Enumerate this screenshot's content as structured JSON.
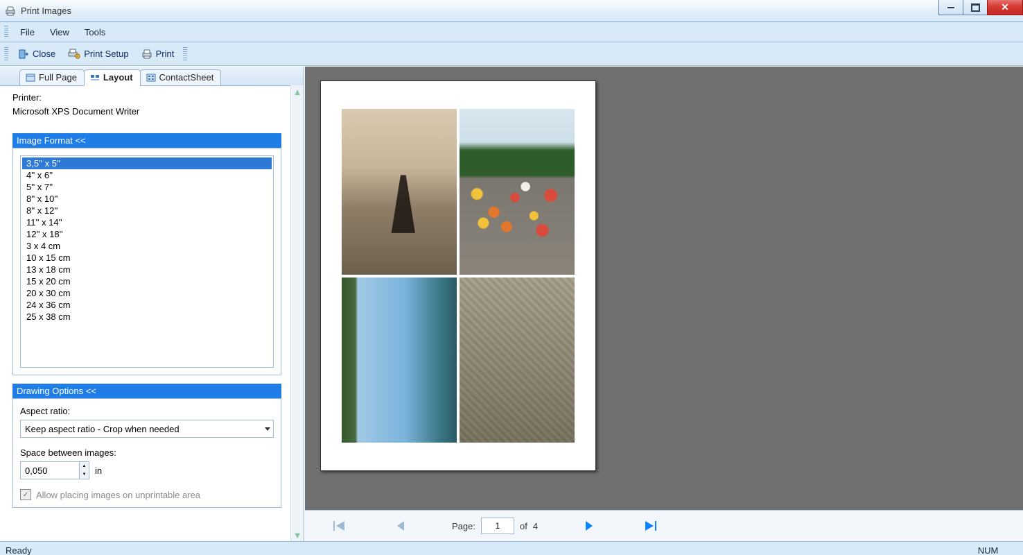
{
  "window": {
    "title": "Print Images"
  },
  "menu": {
    "items": [
      "File",
      "View",
      "Tools"
    ]
  },
  "toolbar": {
    "close": "Close",
    "printSetup": "Print Setup",
    "print": "Print"
  },
  "tabs": {
    "fullPage": "Full Page",
    "layout": "Layout",
    "contactSheet": "ContactSheet"
  },
  "printer": {
    "label": "Printer:",
    "name": "Microsoft XPS Document Writer"
  },
  "imageFormat": {
    "header": "Image Format  <<",
    "options": [
      "3,5'' x 5''",
      "4'' x 6''",
      "5'' x 7''",
      "8'' x 10''",
      "8'' x 12''",
      "11'' x 14''",
      "12'' x 18''",
      "3 x 4 cm",
      "10 x 15 cm",
      "13 x 18 cm",
      "15 x 20 cm",
      "20 x 30 cm",
      "24 x 36 cm",
      "25 x 38 cm"
    ],
    "selectedIndex": 0
  },
  "drawingOptions": {
    "header": "Drawing Options  <<",
    "aspectLabel": "Aspect ratio:",
    "aspectValue": "Keep aspect ratio - Crop when needed",
    "spaceLabel": "Space between images:",
    "spaceValue": "0,050",
    "spaceUnit": "in",
    "unprintableLabel": "Allow placing images on unprintable area"
  },
  "pager": {
    "label": "Page:",
    "current": "1",
    "ofLabel": "of",
    "total": "4"
  },
  "status": {
    "left": "Ready",
    "numLabel": "NUM"
  }
}
